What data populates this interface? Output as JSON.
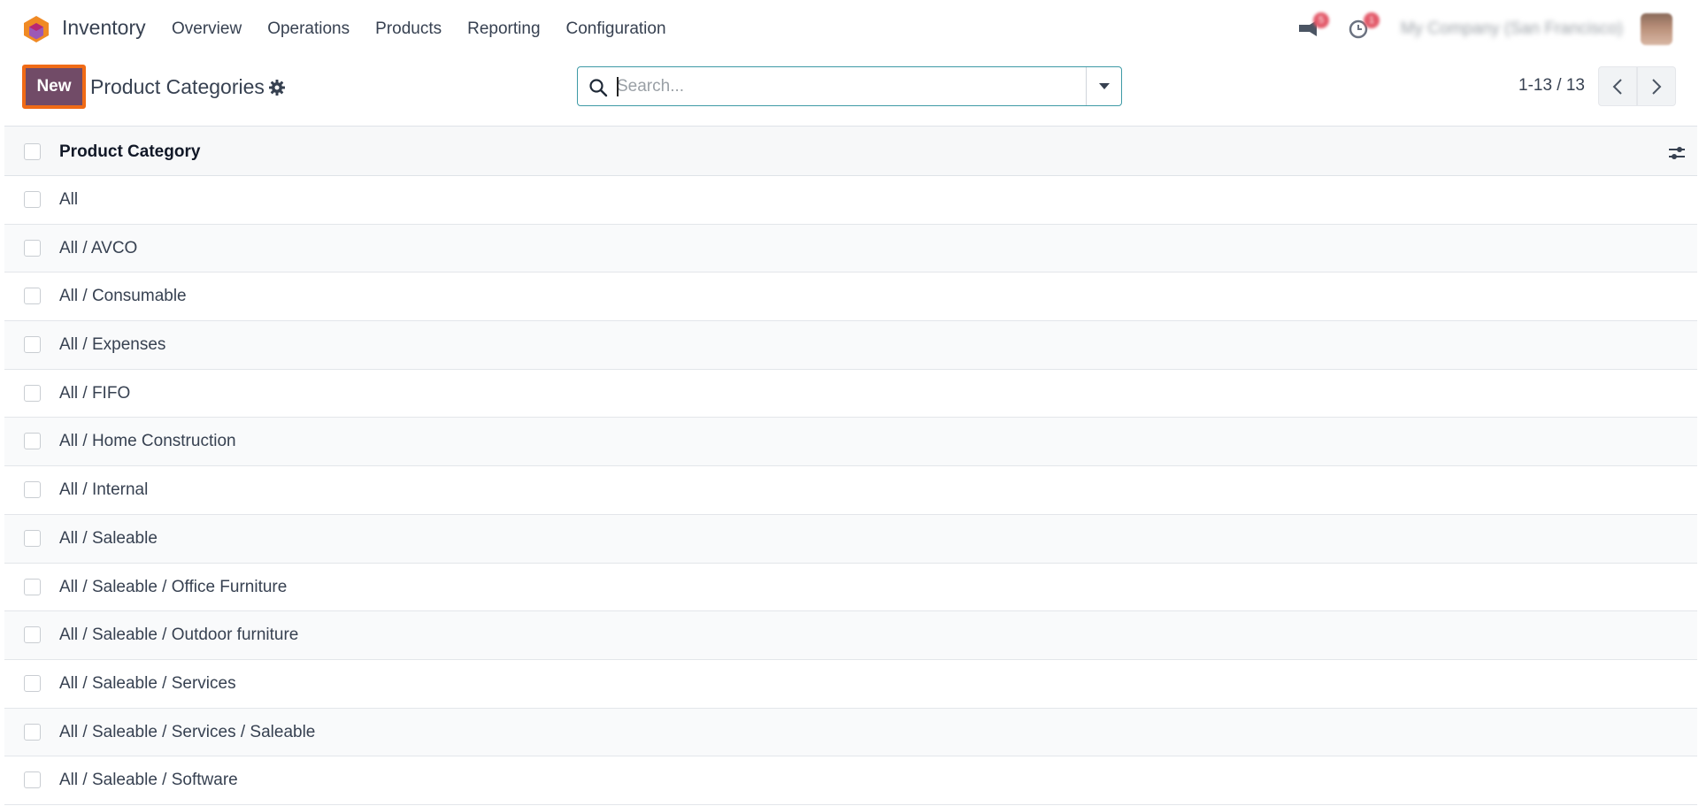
{
  "navbar": {
    "app_name": "Inventory",
    "menu": [
      "Overview",
      "Operations",
      "Products",
      "Reporting",
      "Configuration"
    ],
    "messages_count": "5",
    "activities_count": "1",
    "company": "My Company (San Francisco)"
  },
  "control_panel": {
    "new_label": "New",
    "title": "Product Categories",
    "search_placeholder": "Search...",
    "pager": "1-13 / 13"
  },
  "list": {
    "column_header": "Product Category",
    "rows": [
      "All",
      "All / AVCO",
      "All / Consumable",
      "All / Expenses",
      "All / FIFO",
      "All / Home Construction",
      "All / Internal",
      "All / Saleable",
      "All / Saleable / Office Furniture",
      "All / Saleable / Outdoor furniture",
      "All / Saleable / Services",
      "All / Saleable / Services / Saleable",
      "All / Saleable / Software"
    ]
  },
  "colors": {
    "brand": "#714b67",
    "highlight": "#f06b16",
    "search_border": "#3e9aa6"
  }
}
